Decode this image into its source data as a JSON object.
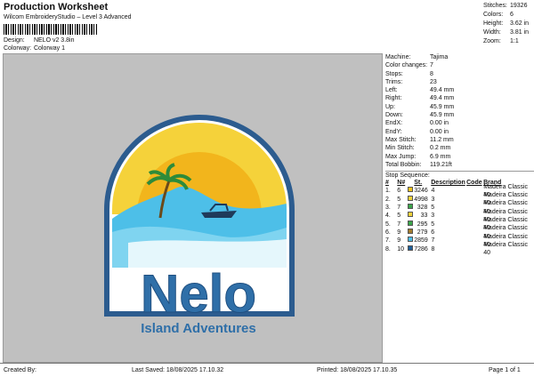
{
  "header": {
    "title": "Production Worksheet",
    "subtitle": "Wilcom EmbroideryStudio – Level 3 Advanced",
    "design_label": "Design:",
    "design_value": "NELO v2 3.8in",
    "colorway_label": "Colorway:",
    "colorway_value": "Colorway 1"
  },
  "stats": [
    {
      "label": "Stitches:",
      "value": "19326"
    },
    {
      "label": "Colors:",
      "value": "6"
    },
    {
      "label": "Height:",
      "value": "3.62 in"
    },
    {
      "label": "Width:",
      "value": "3.81 in"
    },
    {
      "label": "Zoom:",
      "value": "1:1"
    }
  ],
  "details": [
    {
      "label": "Machine:",
      "value": "Tajima"
    },
    {
      "label": "Color changes:",
      "value": "7"
    },
    {
      "label": "Stops:",
      "value": "8"
    },
    {
      "label": "Trims:",
      "value": "23"
    },
    {
      "label": "Left:",
      "value": "49.4 mm"
    },
    {
      "label": "Right:",
      "value": "49.4 mm"
    },
    {
      "label": "Up:",
      "value": "45.9 mm"
    },
    {
      "label": "Down:",
      "value": "45.9 mm"
    },
    {
      "label": "EndX:",
      "value": "0.00 in"
    },
    {
      "label": "EndY:",
      "value": "0.00 in"
    },
    {
      "label": "Max Stitch:",
      "value": "11.2 mm"
    },
    {
      "label": "Min Stitch:",
      "value": "0.2 mm"
    },
    {
      "label": "Max Jump:",
      "value": "6.9 mm"
    },
    {
      "label": "Total Bobbin:",
      "value": "119.21ft"
    }
  ],
  "sequence": {
    "title": "Stop Sequence:",
    "headers": [
      "#",
      "N#",
      "St.",
      "Description",
      "Code",
      "Brand"
    ],
    "rows": [
      {
        "num": "1.",
        "n": "6",
        "color": "#f2c21c",
        "st": "3246",
        "desc": "4",
        "brand": "Madeira Classic 40"
      },
      {
        "num": "2.",
        "n": "5",
        "color": "#f0d23a",
        "st": "4998",
        "desc": "3",
        "brand": "Madeira Classic 40"
      },
      {
        "num": "3.",
        "n": "7",
        "color": "#3aa64a",
        "st": "328",
        "desc": "5",
        "brand": "Madeira Classic 40"
      },
      {
        "num": "4.",
        "n": "5",
        "color": "#f0d23a",
        "st": "33",
        "desc": "3",
        "brand": "Madeira Classic 40"
      },
      {
        "num": "5.",
        "n": "7",
        "color": "#3aa64a",
        "st": "295",
        "desc": "5",
        "brand": "Madeira Classic 40"
      },
      {
        "num": "6.",
        "n": "9",
        "color": "#a37b2c",
        "st": "279",
        "desc": "6",
        "brand": "Madeira Classic 40"
      },
      {
        "num": "7.",
        "n": "9",
        "color": "#4dbfe8",
        "st": "2859",
        "desc": "7",
        "brand": "Madeira Classic 40"
      },
      {
        "num": "8.",
        "n": "10",
        "color": "#1f5f99",
        "st": "7286",
        "desc": "8",
        "brand": "Madeira Classic 40"
      }
    ]
  },
  "logo": {
    "main_text": "Nelo",
    "sub_text": "Island Adventures",
    "border_color": "#2c5c8f",
    "sun_color": "#f2c21c",
    "water_color": "#4dbfe8",
    "text_color": "#2f6fa8"
  },
  "footer": {
    "created_by": "Created By:",
    "last_saved": "Last Saved: 18/08/2025 17.10.32",
    "printed": "Printed: 18/08/2025 17.10.35",
    "page": "Page 1 of 1"
  }
}
